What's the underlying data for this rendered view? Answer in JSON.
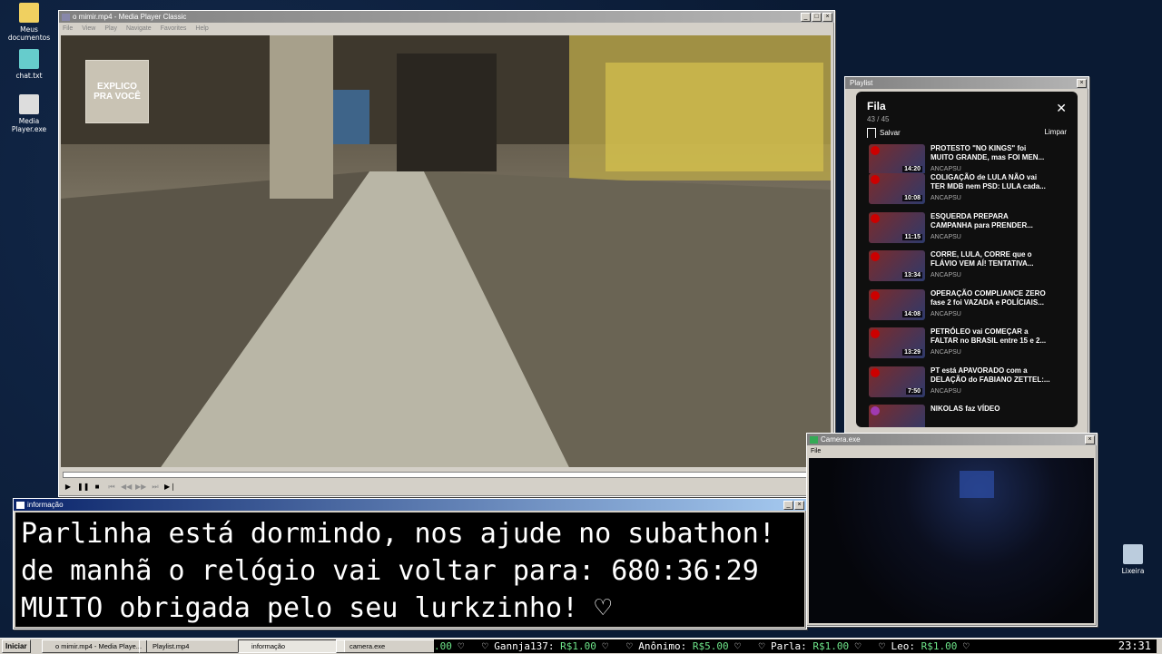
{
  "desktop_icons": [
    {
      "label": "Meus documentos",
      "icon": "folder-icon"
    },
    {
      "label": "chat.txt",
      "icon": "notepad-icon"
    },
    {
      "label": "Media Player.exe",
      "icon": "media-player-icon"
    },
    {
      "label": "Lixeira",
      "icon": "recycle-bin-icon"
    }
  ],
  "mpc": {
    "title": "o mimir.mp4 - Media Player Classic",
    "menu": [
      "File",
      "View",
      "Play",
      "Navigate",
      "Favorites",
      "Help"
    ],
    "logo_text_1": "EXPLICO",
    "logo_text_2": "PRA VOCÊ"
  },
  "playlist": {
    "window_title": "Playlist",
    "heading": "Fila",
    "count": "43 / 45",
    "save_label": "Salvar",
    "clear_label": "Limpar",
    "items": [
      {
        "title_1": "PROTESTO \"NO KINGS\" foi",
        "title_2": "MUITO GRANDE, mas FOI MEN...",
        "channel": "ANCAPSU",
        "duration": "14:20"
      },
      {
        "title_1": "COLIGAÇÃO de LULA NÃO vai",
        "title_2": "TER MDB nem PSD: LULA cada...",
        "channel": "ANCAPSU",
        "duration": "10:08"
      },
      {
        "title_1": "ESQUERDA PREPARA",
        "title_2": "CAMPANHA para PRENDER...",
        "channel": "ANCAPSU",
        "duration": "11:15"
      },
      {
        "title_1": "CORRE, LULA, CORRE que o",
        "title_2": "FLÁVIO VEM AÍ! TENTATIVA...",
        "channel": "ANCAPSU",
        "duration": "13:34"
      },
      {
        "title_1": "OPERAÇÃO COMPLIANCE ZERO",
        "title_2": "fase 2 foi VAZADA e POLÍCIAIS...",
        "channel": "ANCAPSU",
        "duration": "14:08"
      },
      {
        "title_1": "PETRÓLEO vai COMEÇAR a",
        "title_2": "FALTAR no BRASIL entre 15 e 2...",
        "channel": "ANCAPSU",
        "duration": "13:29"
      },
      {
        "title_1": "PT está APAVORADO com a",
        "title_2": "DELAÇÃO do FABIANO ZETTEL:...",
        "channel": "ANCAPSU",
        "duration": "7:50"
      },
      {
        "title_1": "NIKOLAS faz VÍDEO",
        "title_2": "",
        "channel": "",
        "duration": ""
      }
    ]
  },
  "info": {
    "title": "informação",
    "line1": "Parlinha está dormindo, nos ajude no subathon!",
    "line2": "de manhã o relógio vai voltar para:  680:36:29",
    "line3": "MUITO obrigada pelo seu lurkzinho! ♡"
  },
  "camera": {
    "title": "Camera.exe",
    "menu_file": "File"
  },
  "taskbar": {
    "start_label": "Iniciar",
    "tasks": [
      {
        "label": "o mimir.mp4 - Media Playe..."
      },
      {
        "label": "Playlist.mp4"
      },
      {
        "label": "informação"
      },
      {
        "label": "camera.exe"
      }
    ],
    "ticker": [
      {
        "name": "",
        "amount": ".00"
      },
      {
        "name": "Gannja137:",
        "amount": "R$1.00"
      },
      {
        "name": "Anônimo:",
        "amount": "R$5.00"
      },
      {
        "name": "Parla:",
        "amount": "R$1.00"
      },
      {
        "name": "Leo:",
        "amount": "R$1.00"
      }
    ],
    "heart": "♡",
    "clock": "23:31"
  }
}
